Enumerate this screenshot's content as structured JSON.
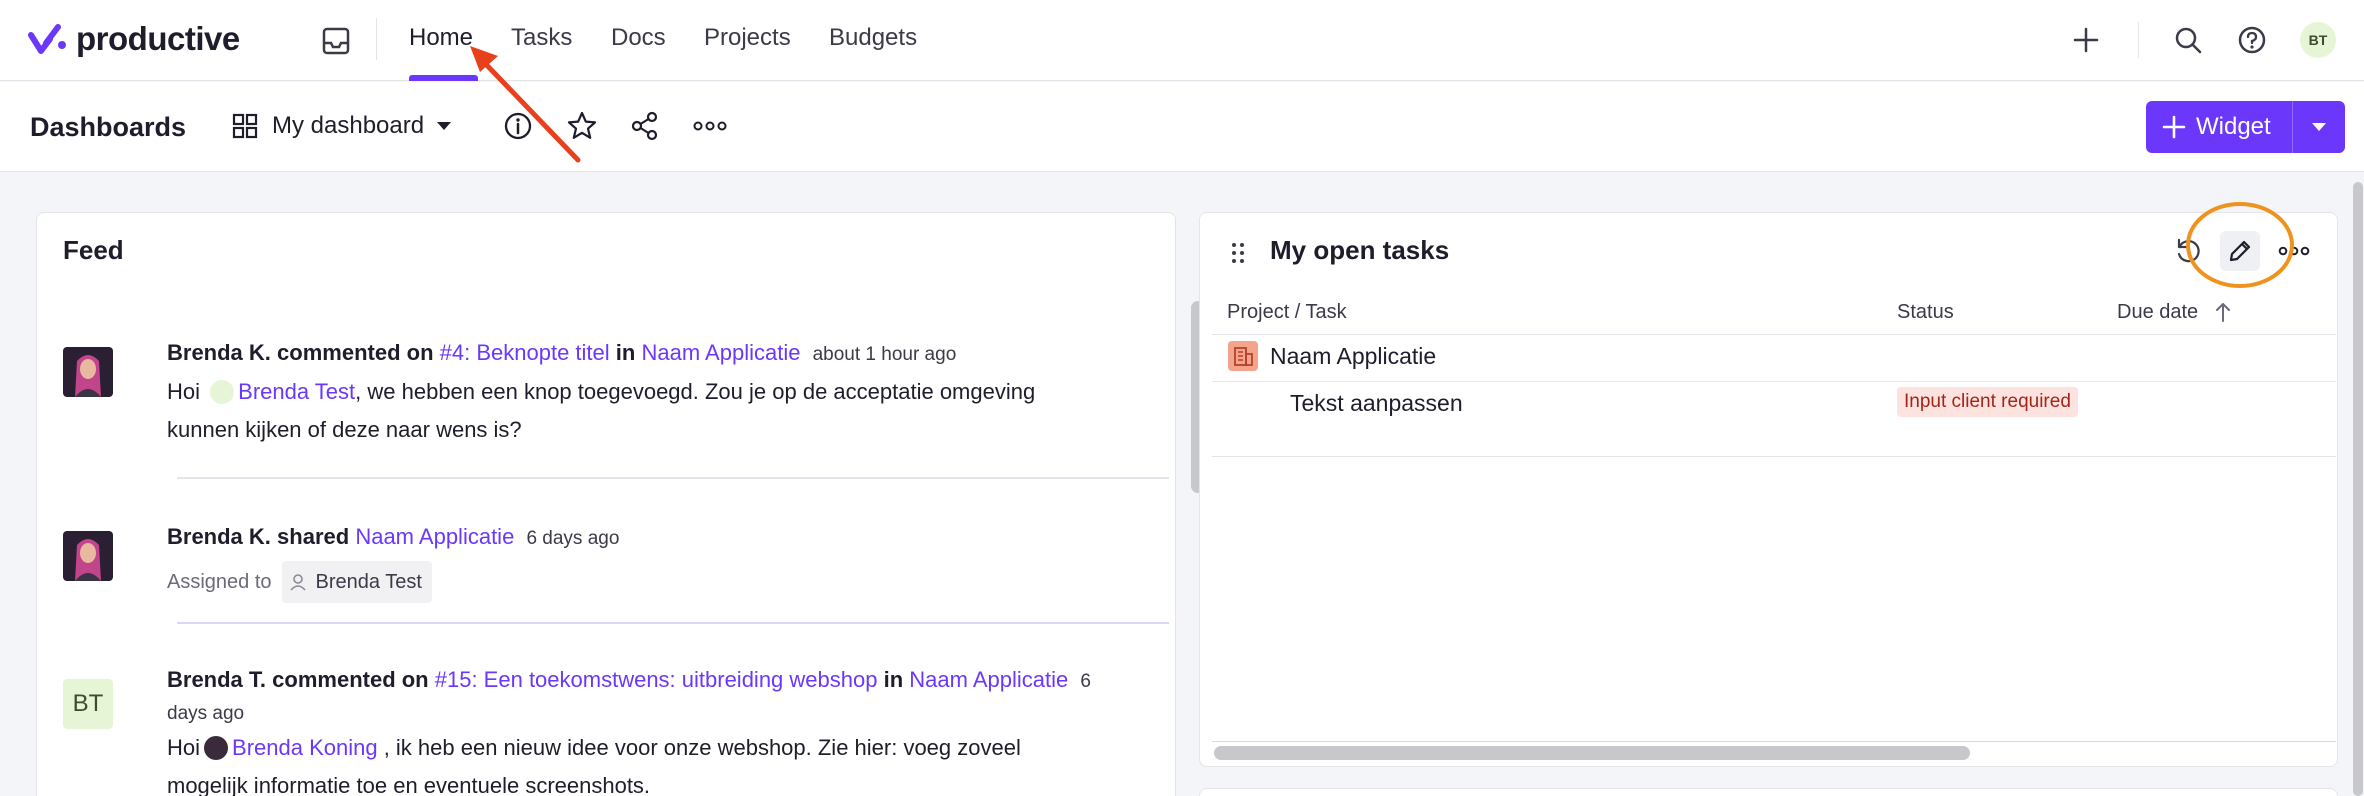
{
  "brand": {
    "name": "productive",
    "accent": "#6b38fb"
  },
  "nav": {
    "items": [
      {
        "label": "Home",
        "active": true
      },
      {
        "label": "Tasks"
      },
      {
        "label": "Docs"
      },
      {
        "label": "Projects"
      },
      {
        "label": "Budgets"
      }
    ],
    "icons": [
      "inbox-icon",
      "plus-icon",
      "search-icon",
      "help-icon"
    ],
    "avatar_initials": "BT"
  },
  "toolbar": {
    "title": "Dashboards",
    "dashboard_select": "My dashboard",
    "icons": [
      "info-icon",
      "star-icon",
      "share-icon",
      "more-icon"
    ],
    "widget_button": "Widget"
  },
  "feed": {
    "title": "Feed",
    "items": [
      {
        "author": "Brenda K.",
        "action": "commented on",
        "target": "#4: Beknopte titel",
        "in": "in",
        "project": "Naam Applicatie",
        "time": "about 1 hour ago",
        "body_prefix": "Hoi",
        "mention": "Brenda Test",
        "body_line1": ", we hebben een knop toegevoegd. Zou je op de acceptatie omgeving",
        "body_line2": "kunnen kijken of deze naar wens is?"
      },
      {
        "author": "Brenda K.",
        "action": "shared",
        "project": "Naam Applicatie",
        "time": "6 days ago",
        "assigned_label": "Assigned to",
        "assignee": "Brenda Test"
      },
      {
        "avatar_initials": "BT",
        "author": "Brenda T.",
        "action": "commented on",
        "target": "#15: Een toekomstwens: uitbreiding webshop",
        "in": "in",
        "project": "Naam Applicatie",
        "time_part1": "6",
        "time_part2": "days ago",
        "body_prefix": "Hoi",
        "mention": "Brenda Koning",
        "body_line1": " , ik heb een nieuw idee voor onze webshop. Zie hier: voeg zoveel",
        "body_line2": "mogelijk informatie toe en eventuele screenshots."
      }
    ]
  },
  "tasks": {
    "title": "My open tasks",
    "columns": [
      "Project / Task",
      "Status",
      "Due date"
    ],
    "project": "Naam Applicatie",
    "rows": [
      {
        "task": "Tekst aanpassen",
        "status": "Input client required",
        "due": ""
      }
    ],
    "status_color": "#fde3e0"
  },
  "annotations": {
    "arrow_color": "#e8401c",
    "circle_color": "#f0931e"
  }
}
